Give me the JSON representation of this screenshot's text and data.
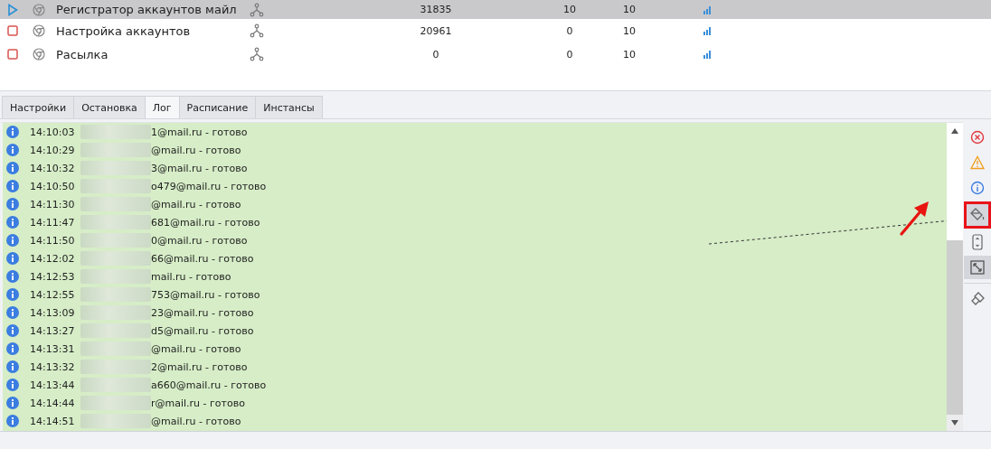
{
  "tasks": [
    {
      "kind": "running",
      "selected": true,
      "name": "Регистратор аккаунтов майл",
      "count": "31835",
      "column_4": "10",
      "column_5": "10"
    },
    {
      "kind": "stopped",
      "selected": false,
      "name": "Настройка аккаунтов",
      "count": "20961",
      "column_4": "0",
      "column_5": "10"
    },
    {
      "kind": "stopped",
      "selected": false,
      "name": "Расылка",
      "count": "0",
      "column_4": "0",
      "column_5": "10"
    }
  ],
  "tabs": [
    {
      "label": "Настройки",
      "selected": false
    },
    {
      "label": "Остановка",
      "selected": false
    },
    {
      "label": "Лог",
      "selected": true
    },
    {
      "label": "Расписание",
      "selected": false
    },
    {
      "label": "Инстансы",
      "selected": false
    }
  ],
  "log": [
    {
      "time": "14:10:03",
      "text": "1@mail.ru - готово"
    },
    {
      "time": "14:10:29",
      "text": "@mail.ru - готово"
    },
    {
      "time": "14:10:32",
      "text": "3@mail.ru - готово"
    },
    {
      "time": "14:10:50",
      "text": "o479@mail.ru - готово"
    },
    {
      "time": "14:11:30",
      "text": "@mail.ru - готово"
    },
    {
      "time": "14:11:47",
      "text": "681@mail.ru - готово"
    },
    {
      "time": "14:11:50",
      "text": "0@mail.ru - готово"
    },
    {
      "time": "14:12:02",
      "text": "66@mail.ru - готово"
    },
    {
      "time": "14:12:53",
      "text": "mail.ru - готово"
    },
    {
      "time": "14:12:55",
      "text": "753@mail.ru - готово"
    },
    {
      "time": "14:13:09",
      "text": "23@mail.ru - готово"
    },
    {
      "time": "14:13:27",
      "text": "d5@mail.ru - готово"
    },
    {
      "time": "14:13:31",
      "text": "@mail.ru - готово"
    },
    {
      "time": "14:13:32",
      "text": "2@mail.ru - готово"
    },
    {
      "time": "14:13:44",
      "text": "a660@mail.ru - готово"
    },
    {
      "time": "14:14:44",
      "text": "r@mail.ru - готово"
    },
    {
      "time": "14:14:51",
      "text": "@mail.ru - готово"
    }
  ],
  "toolbar": [
    {
      "kind": "error",
      "active": false
    },
    {
      "kind": "warning",
      "active": false
    },
    {
      "kind": "info",
      "active": false
    },
    {
      "kind": "bucket",
      "active": true,
      "highlighted": true
    },
    {
      "kind": "scroll",
      "active": false
    },
    {
      "kind": "expand",
      "active": true
    },
    {
      "kind": "brush",
      "active": false
    }
  ]
}
